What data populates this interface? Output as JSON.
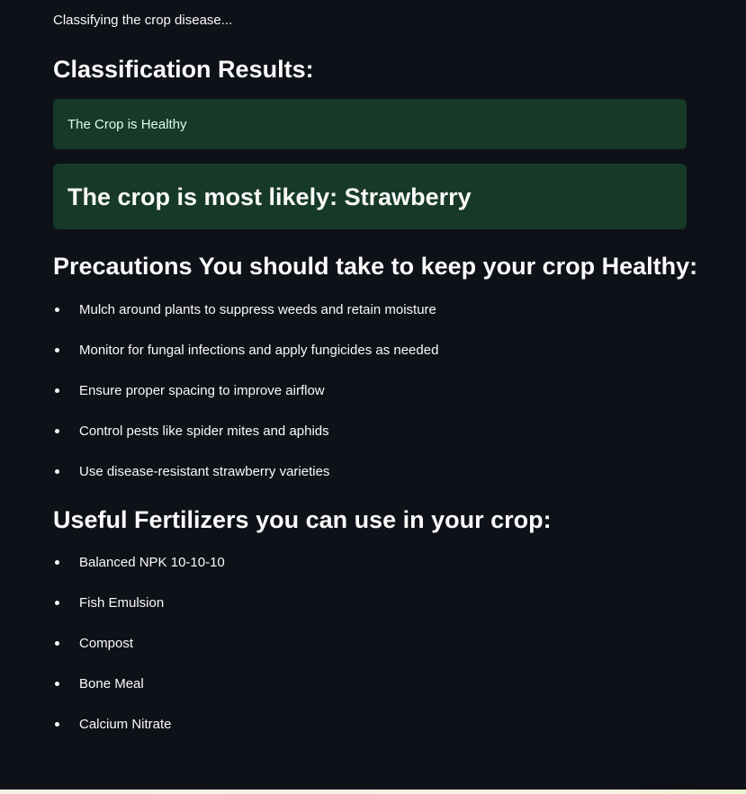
{
  "status": {
    "text": "Classifying the crop disease..."
  },
  "results": {
    "heading": "Classification Results:",
    "health_message": "The Crop is Healthy",
    "crop_message": "The crop is most likely: Strawberry"
  },
  "precautions": {
    "heading": "Precautions You should take to keep your crop Healthy:",
    "items": [
      "Mulch around plants to suppress weeds and retain moisture",
      "Monitor for fungal infections and apply fungicides as needed",
      "Ensure proper spacing to improve airflow",
      "Control pests like spider mites and aphids",
      "Use disease-resistant strawberry varieties"
    ]
  },
  "fertilizers": {
    "heading": "Useful Fertilizers you can use in your crop:",
    "items": [
      "Balanced NPK 10-10-10",
      "Fish Emulsion",
      "Compost",
      "Bone Meal",
      "Calcium Nitrate"
    ]
  },
  "colors": {
    "background": "#0e1117",
    "success_box": "#173928",
    "success_text": "#dffde9",
    "text": "#fafafa"
  }
}
